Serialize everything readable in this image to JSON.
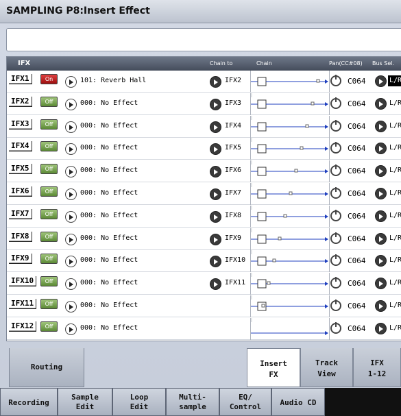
{
  "title": "SAMPLING P8:Insert Effect",
  "header": {
    "ifx": "IFX",
    "chain_to": "Chain to",
    "chain": "Chain",
    "pan": "Pan(CC#08)",
    "bus_sel": "Bus Sel."
  },
  "rows": [
    {
      "label": "IFX1",
      "state": "On",
      "effect": "101: Reverb Hall",
      "chain_to": "IFX2",
      "pan": "C064",
      "bus": "L/R",
      "bus_selected": true,
      "chain_line": true
    },
    {
      "label": "IFX2",
      "state": "Off",
      "effect": "000: No Effect",
      "chain_to": "IFX3",
      "pan": "C064",
      "bus": "L/R",
      "chain_line": true
    },
    {
      "label": "IFX3",
      "state": "Off",
      "effect": "000: No Effect",
      "chain_to": "IFX4",
      "pan": "C064",
      "bus": "L/R",
      "chain_line": true
    },
    {
      "label": "IFX4",
      "state": "Off",
      "effect": "000: No Effect",
      "chain_to": "IFX5",
      "pan": "C064",
      "bus": "L/R",
      "chain_line": true
    },
    {
      "label": "IFX5",
      "state": "Off",
      "effect": "000: No Effect",
      "chain_to": "IFX6",
      "pan": "C064",
      "bus": "L/R",
      "chain_line": true
    },
    {
      "label": "IFX6",
      "state": "Off",
      "effect": "000: No Effect",
      "chain_to": "IFX7",
      "pan": "C064",
      "bus": "L/R",
      "chain_line": true
    },
    {
      "label": "IFX7",
      "state": "Off",
      "effect": "000: No Effect",
      "chain_to": "IFX8",
      "pan": "C064",
      "bus": "L/R",
      "chain_line": true
    },
    {
      "label": "IFX8",
      "state": "Off",
      "effect": "000: No Effect",
      "chain_to": "IFX9",
      "pan": "C064",
      "bus": "L/R",
      "chain_line": true
    },
    {
      "label": "IFX9",
      "state": "Off",
      "effect": "000: No Effect",
      "chain_to": "IFX10",
      "pan": "C064",
      "bus": "L/R",
      "chain_line": true
    },
    {
      "label": "IFX10",
      "state": "Off",
      "effect": "000: No Effect",
      "chain_to": "IFX11",
      "pan": "C064",
      "bus": "L/R",
      "chain_line": true
    },
    {
      "label": "IFX11",
      "state": "Off",
      "effect": "000: No Effect",
      "chain_to": "",
      "pan": "C064",
      "bus": "L/R",
      "chain_line": true
    },
    {
      "label": "IFX12",
      "state": "Off",
      "effect": "000: No Effect",
      "chain_to": "",
      "pan": "C064",
      "bus": "L/R",
      "chain_line": false
    }
  ],
  "top_tabs": [
    {
      "label": "Routing"
    },
    {
      "label": "Insert\nFX",
      "active": true
    },
    {
      "label": "Track\nView"
    },
    {
      "label": "IFX\n1-12"
    }
  ],
  "bottom_tabs": [
    {
      "label": "Recording"
    },
    {
      "label": "Sample\nEdit"
    },
    {
      "label": "Loop\nEdit"
    },
    {
      "label": "Multi-\nsample"
    },
    {
      "label": "EQ/\nControl"
    },
    {
      "label": "Audio CD"
    }
  ],
  "colors": {
    "chain_line": "#1f3fbf",
    "on": "#c81818",
    "off": "#6c9a44"
  }
}
